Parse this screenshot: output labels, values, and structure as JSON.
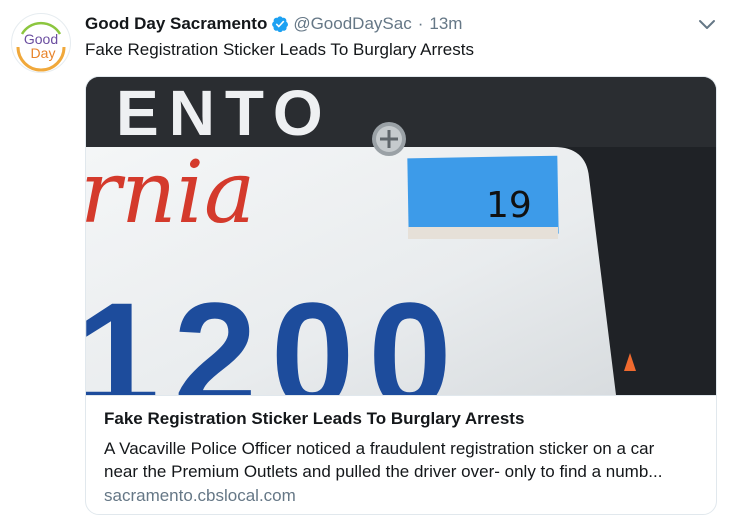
{
  "tweet": {
    "author": {
      "display_name": "Good Day Sacramento",
      "handle": "@GoodDaySac",
      "avatar_text_line1": "Good",
      "avatar_text_line2": "Day",
      "verified": true
    },
    "separator": "·",
    "timestamp": "13m",
    "text": "Fake Registration Sticker Leads To Burglary Arrests",
    "menu_icon": "chevron-down-icon"
  },
  "card": {
    "image": {
      "plate_text_top": "ENTO",
      "plate_script": "rnia",
      "sticker_text": "19",
      "plate_number": "1200"
    },
    "title": "Fake Registration Sticker Leads To Burglary Arrests",
    "description_line1": "A Vacaville Police Officer noticed a fraudulent registration sticker on a car",
    "description_line2": "near the Premium Outlets and pulled the driver over- only to find a numb...",
    "domain": "sacramento.cbslocal.com"
  },
  "colors": {
    "text": "#14171a",
    "secondary": "#657786",
    "verified": "#1da1f2",
    "border": "#e1e8ed",
    "sticker_blue": "#3d9be9",
    "plate_number_blue": "#1d4c9c",
    "plate_script_red": "#d43a2c",
    "avatar_orange": "#f0a83b"
  }
}
